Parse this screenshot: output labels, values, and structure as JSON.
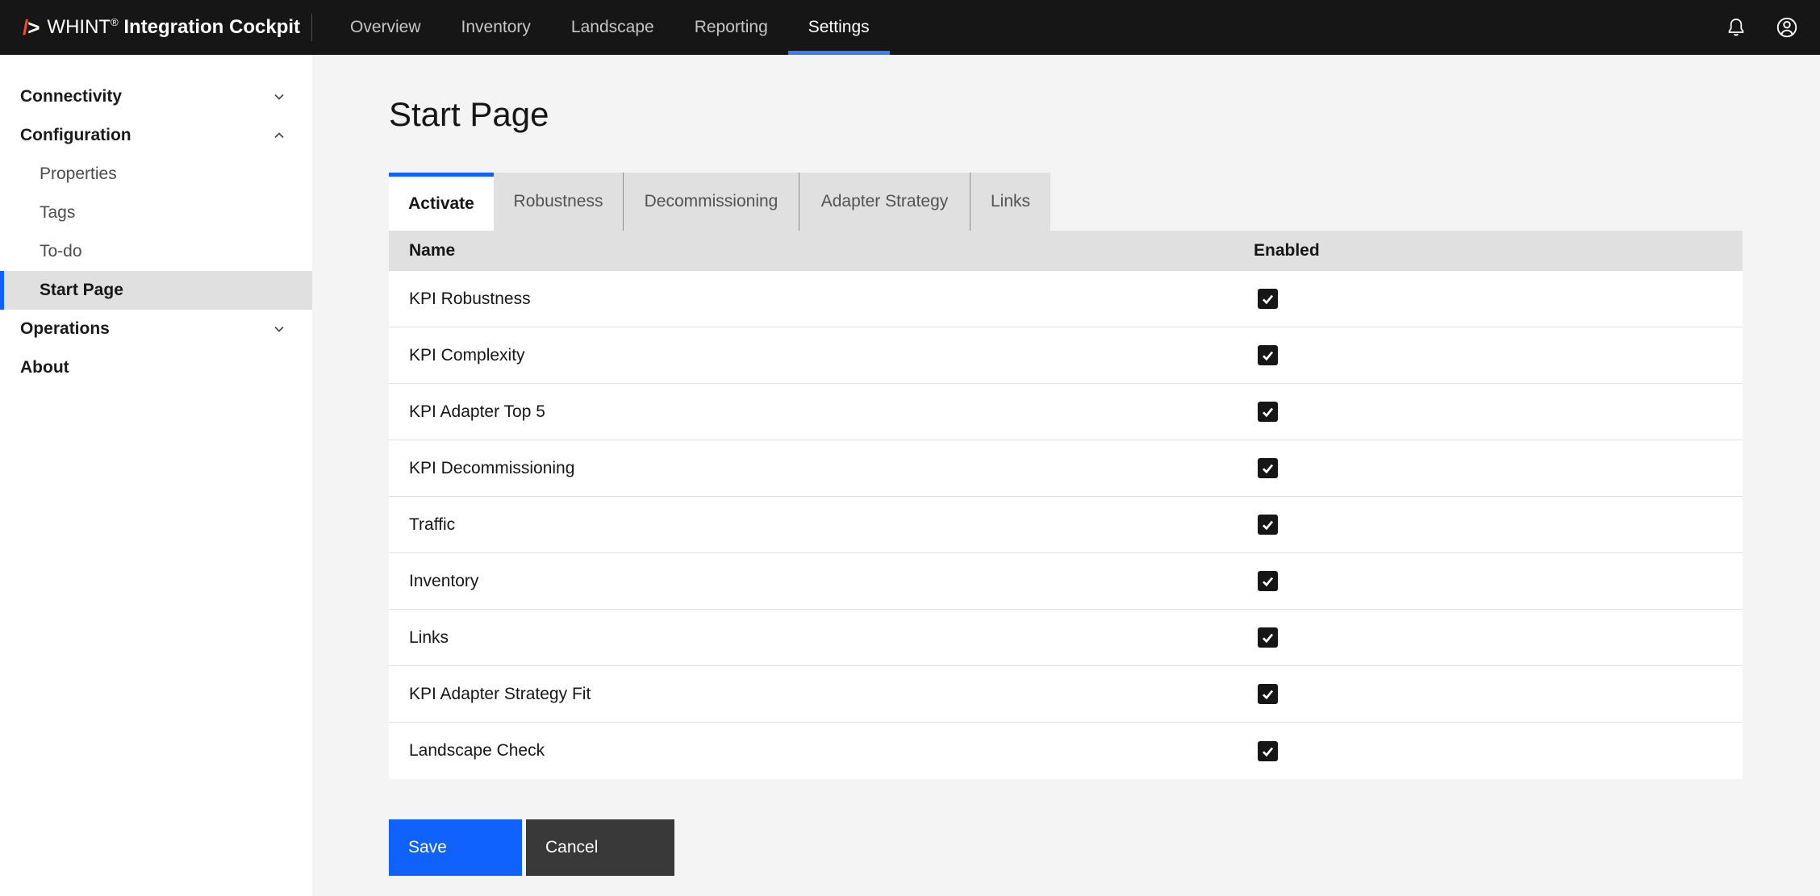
{
  "header": {
    "logo": {
      "mark_slash": "/",
      "mark_arrow": ">",
      "brand_regular": "WHINT",
      "brand_reg_mark": "®",
      "brand_bold": "Integration Cockpit"
    },
    "nav": [
      {
        "label": "Overview",
        "active": false
      },
      {
        "label": "Inventory",
        "active": false
      },
      {
        "label": "Landscape",
        "active": false
      },
      {
        "label": "Reporting",
        "active": false
      },
      {
        "label": "Settings",
        "active": true
      }
    ],
    "icons": [
      "bell-notifications-icon",
      "user-account-icon"
    ]
  },
  "sidebar": {
    "items": [
      {
        "label": "Connectivity",
        "type": "section",
        "chevron": "down"
      },
      {
        "label": "Configuration",
        "type": "section",
        "chevron": "up"
      },
      {
        "label": "Properties",
        "type": "sub"
      },
      {
        "label": "Tags",
        "type": "sub"
      },
      {
        "label": "To-do",
        "type": "sub"
      },
      {
        "label": "Start Page",
        "type": "sub",
        "selected": true
      },
      {
        "label": "Operations",
        "type": "section",
        "chevron": "down"
      },
      {
        "label": "About",
        "type": "section"
      }
    ]
  },
  "main": {
    "page_title": "Start Page",
    "tabs": [
      {
        "label": "Activate",
        "active": true
      },
      {
        "label": "Robustness",
        "active": false
      },
      {
        "label": "Decommissioning",
        "active": false
      },
      {
        "label": "Adapter Strategy",
        "active": false
      },
      {
        "label": "Links",
        "active": false
      }
    ],
    "table": {
      "columns": {
        "name": "Name",
        "enabled": "Enabled"
      },
      "rows": [
        {
          "name": "KPI Robustness",
          "enabled": true
        },
        {
          "name": "KPI Complexity",
          "enabled": true
        },
        {
          "name": "KPI Adapter Top 5",
          "enabled": true
        },
        {
          "name": "KPI Decommissioning",
          "enabled": true
        },
        {
          "name": "Traffic",
          "enabled": true
        },
        {
          "name": "Inventory",
          "enabled": true
        },
        {
          "name": "Links",
          "enabled": true
        },
        {
          "name": "KPI Adapter Strategy Fit",
          "enabled": true
        },
        {
          "name": "Landscape Check",
          "enabled": true
        }
      ]
    },
    "buttons": {
      "save": "Save",
      "cancel": "Cancel"
    }
  },
  "colors": {
    "header_bg": "#161616",
    "accent_blue": "#0f62fe",
    "nav_active_underline": "#3d7bfd",
    "logo_slash_orange": "#fb4b1e",
    "sidebar_selected_bg": "#e0e0e0",
    "table_header_bg": "#e0e0e0",
    "content_bg": "#f4f4f4",
    "save_button_bg": "#0f62fe",
    "cancel_button_bg": "#393939"
  }
}
